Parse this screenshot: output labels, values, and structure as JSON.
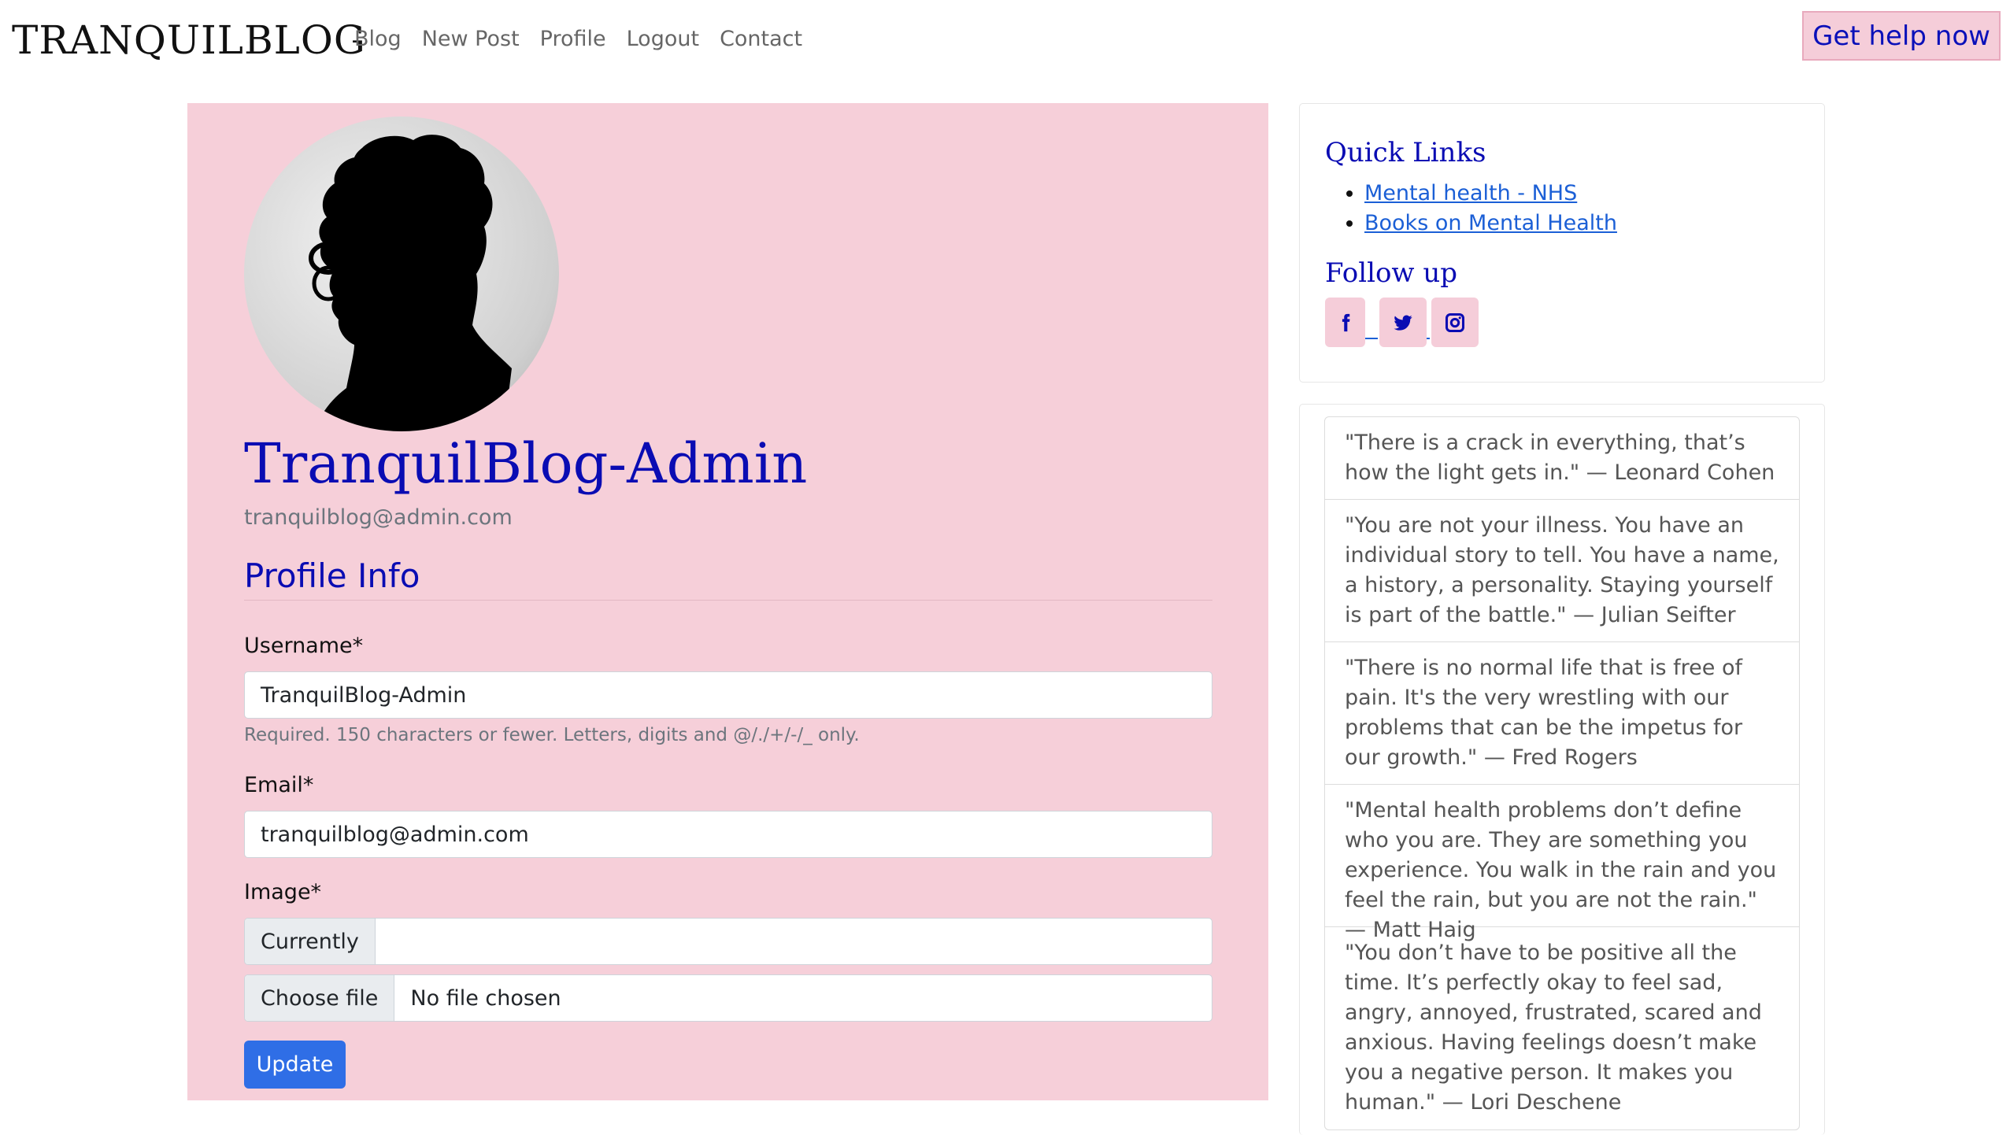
{
  "navbar": {
    "brand": "TRANQUILBLOG",
    "links": [
      "Blog",
      "New Post",
      "Profile",
      "Logout",
      "Contact"
    ],
    "help_button": "Get help now"
  },
  "profile": {
    "username": "TranquilBlog-Admin",
    "email": "tranquilblog@admin.com",
    "section_title": "Profile Info"
  },
  "form": {
    "username_label": "Username*",
    "username_value": "TranquilBlog-Admin",
    "username_help": "Required. 150 characters or fewer. Letters, digits and @/./+/-/_ only.",
    "email_label": "Email*",
    "email_value": "tranquilblog@admin.com",
    "image_label": "Image*",
    "currently_label": "Currently",
    "currently_value": "",
    "choose_file_label": "Choose file",
    "file_status": "No file chosen",
    "submit_label": "Update"
  },
  "sidebar": {
    "quick_links_title": "Quick Links",
    "quick_links": [
      "Mental health - NHS",
      "Books on Mental Health"
    ],
    "follow_title": "Follow up",
    "social_icons": [
      "facebook-icon",
      "twitter-icon",
      "instagram-icon"
    ],
    "quotes": [
      "\"There is a crack in everything, that’s how the light gets in.\" — Leonard Cohen",
      "\"You are not your illness. You have an individual story to tell. You have a name, a history, a personality. Staying yourself is part of the battle.\" — Julian Seifter",
      "\"There is no normal life that is free of pain. It's the very wrestling with our problems that can be the impetus for our growth.\" — Fred Rogers",
      "\"Mental health problems don’t define who you are. They are something you experience. You walk in the rain and you feel the rain, but you are not the rain.\" — Matt Haig",
      "\"You don’t have to be positive all the time. It’s perfectly okay to feel sad, angry, annoyed, frustrated, scared and anxious. Having feelings doesn’t make you a negative person. It makes you human.\" — Lori Deschene"
    ]
  },
  "colors": {
    "accent": "#0a0cb3",
    "panel_pink": "#f6cfd9",
    "button_blue": "#2f6ee6",
    "link_blue": "#1b5fd6"
  }
}
